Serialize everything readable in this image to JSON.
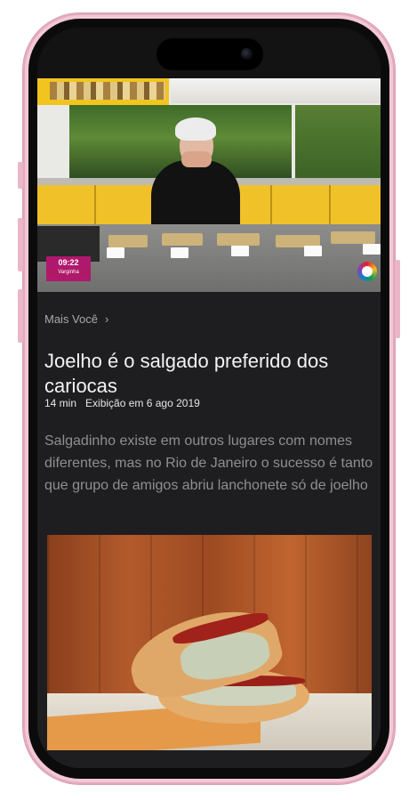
{
  "video": {
    "badge_time": "09:22",
    "badge_channel": "Varginha"
  },
  "article": {
    "breadcrumb": "Mais Você",
    "title": "Joelho é o salgado preferido dos cariocas",
    "duration": "14 min",
    "aired": "Exibição em 6 ago 2019",
    "description": "Salgadinho existe em outros lugares com nomes diferentes, mas no Rio de Janeiro o sucesso é tanto que grupo de amigos abriu lanchonete só de joelho"
  },
  "colors": {
    "screen_bg": "#1e1e20",
    "frame": "#f2c8d6",
    "badge": "#b0186e"
  }
}
